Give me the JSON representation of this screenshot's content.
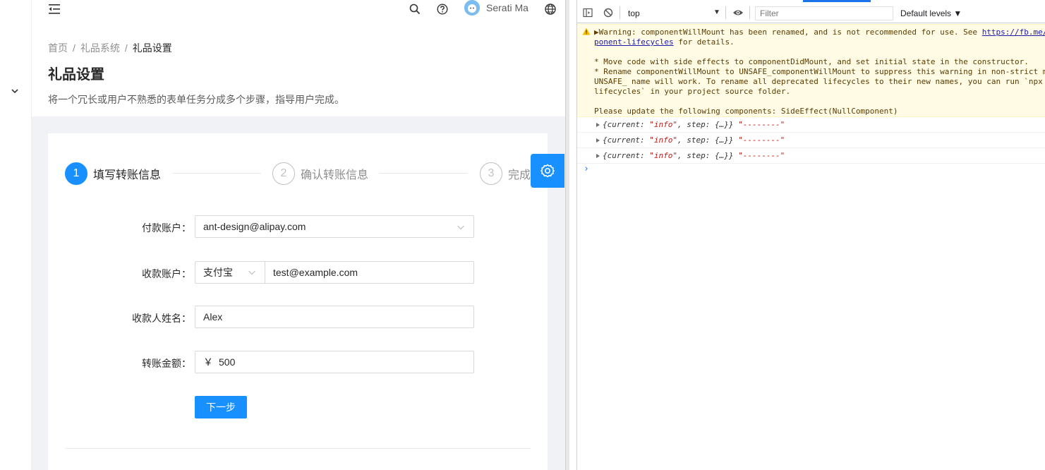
{
  "header": {
    "username": "Serati Ma"
  },
  "breadcrumb": {
    "items": [
      "首页",
      "礼品系统",
      "礼品设置"
    ],
    "separator": "/"
  },
  "page": {
    "title": "礼品设置",
    "description": "将一个冗长或用户不熟悉的表单任务分成多个步骤，指导用户完成。"
  },
  "steps": [
    {
      "num": "1",
      "label": "填写转账信息"
    },
    {
      "num": "2",
      "label": "确认转账信息"
    },
    {
      "num": "3",
      "label": "完成"
    }
  ],
  "form": {
    "pay_account_label": "付款账户：",
    "pay_account_value": "ant-design@alipay.com",
    "recv_account_label": "收款账户：",
    "recv_type_value": "支付宝",
    "recv_account_value": "test@example.com",
    "recv_name_label": "收款人姓名：",
    "recv_name_value": "Alex",
    "amount_label": "转账金额：",
    "amount_prefix": "￥",
    "amount_value": "500",
    "next_button": "下一步"
  },
  "devtools": {
    "context": "top",
    "filter_placeholder": "Filter",
    "levels": "Default levels ▼",
    "warning_lines": [
      "▶Warning: componentWillMount has been renamed, and is not recommended for use. See ",
      "ponent-lifecycles",
      " for details.",
      "* Move code with side effects to componentDidMount, and set initial state in the constructor.",
      "* Rename componentWillMount to UNSAFE_componentWillMount to suppress this warning in non-strict m",
      "UNSAFE_ name will work. To rename all deprecated lifecycles to their new names, you can run `npx",
      "lifecycles` in your project source folder.",
      "Please update the following components: SideEffect(NullComponent)"
    ],
    "warning_link": "https://fb.me/",
    "log_prefix": "{current: ",
    "log_value": "\"info\"",
    "log_suffix": ", step: {…}} ",
    "log_dashes": "\"--------\"",
    "prompt": "›"
  },
  "colors": {
    "primary": "#1890ff",
    "warning_bg": "#fffbe5"
  }
}
